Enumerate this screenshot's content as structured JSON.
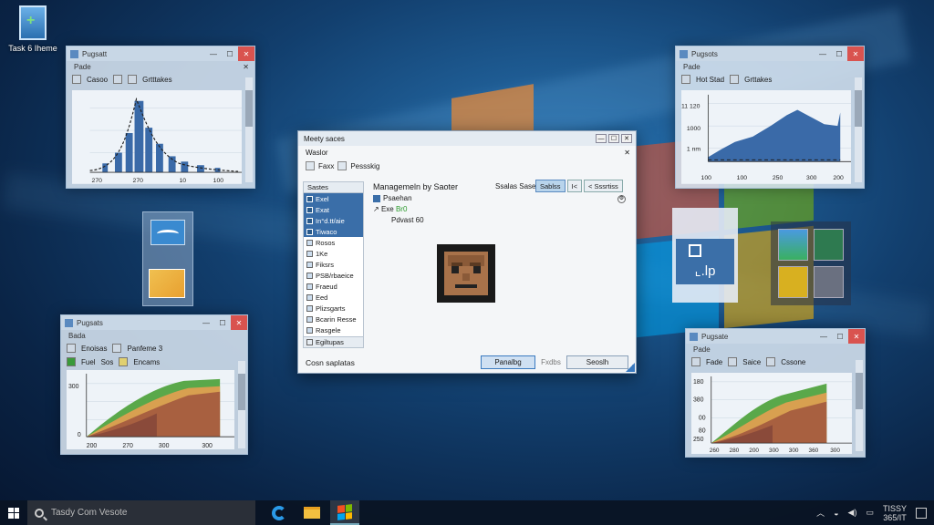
{
  "desktop": {
    "icon_label": "Task 6 Iheme"
  },
  "windows": {
    "top_left": {
      "title": "Pugsatt",
      "menu": "Pade",
      "toolbar": [
        "Casoo",
        "Grtttakes"
      ],
      "axis_x": [
        "270",
        "270",
        "10",
        "100"
      ],
      "chart_type": "bar-histogram"
    },
    "bottom_left": {
      "title": "Pugsats",
      "menu": "Bada",
      "toolbar": [
        "Enoisas",
        "Panfeme 3"
      ],
      "toolbar2": [
        "Fuel",
        "Sos",
        "Encams"
      ],
      "axis_y": [
        "300",
        "0"
      ],
      "axis_x": [
        "200",
        "270",
        "300",
        "300"
      ],
      "chart_type": "stacked-area"
    },
    "top_right": {
      "title": "Pugsots",
      "menu": "Pade",
      "toolbar": [
        "Hot Stad",
        "Grttakes"
      ],
      "axis_y": [
        "11 120",
        "1000",
        "1 nm"
      ],
      "axis_x": [
        "100",
        "100",
        "250",
        "300",
        "200"
      ],
      "chart_type": "area"
    },
    "bottom_right": {
      "title": "Pugsate",
      "menu": "Pade",
      "toolbar": [
        "Fade",
        "Saice",
        "Cssone"
      ],
      "axis_y": [
        "180",
        "380",
        "00",
        "80",
        "250"
      ],
      "axis_x": [
        "260",
        "280",
        "200",
        "300",
        "300",
        "360",
        "300"
      ],
      "chart_type": "stacked-area"
    }
  },
  "dialog": {
    "title": "Meety saces",
    "subtitle": "Waslor",
    "toolbar": [
      "Faxx",
      "Pessskig"
    ],
    "list_header": "Sastes",
    "list_items": [
      {
        "label": "Exel",
        "selected": true
      },
      {
        "label": "Exat",
        "selected": true
      },
      {
        "label": "In°d.tt/aie",
        "selected": true
      },
      {
        "label": "Tiwaco",
        "selected": true
      },
      {
        "label": "Rosos",
        "selected": false
      },
      {
        "label": "1Ke",
        "selected": false
      },
      {
        "label": "Fiksrs",
        "selected": false
      },
      {
        "label": "PSB/rbaeice",
        "selected": false
      },
      {
        "label": "Fraeud",
        "selected": false
      },
      {
        "label": "Eed",
        "selected": false
      },
      {
        "label": "Plizsgarts",
        "selected": false
      },
      {
        "label": "Bcarin Resse",
        "selected": false
      },
      {
        "label": "Rasgele",
        "selected": false
      }
    ],
    "list_footer": "Egiltupas",
    "right_heading": "Managemeln by Saoter",
    "search_label": "Ssalas Sase",
    "top_buttons": [
      "Sablss",
      "I<",
      "< Sssrtiss"
    ],
    "tree": [
      "Psaehan",
      "Exe",
      "Br0",
      "Pdvast 60"
    ],
    "status": "Cosn saplatas",
    "buttons": {
      "primary": "Panalbg",
      "middle": "Fxdbs",
      "secondary": "Seoslh"
    }
  },
  "taskbar": {
    "search_placeholder": "Tasdy Com Vesote",
    "clock_time": "TISSY",
    "clock_date": "365/IT"
  }
}
